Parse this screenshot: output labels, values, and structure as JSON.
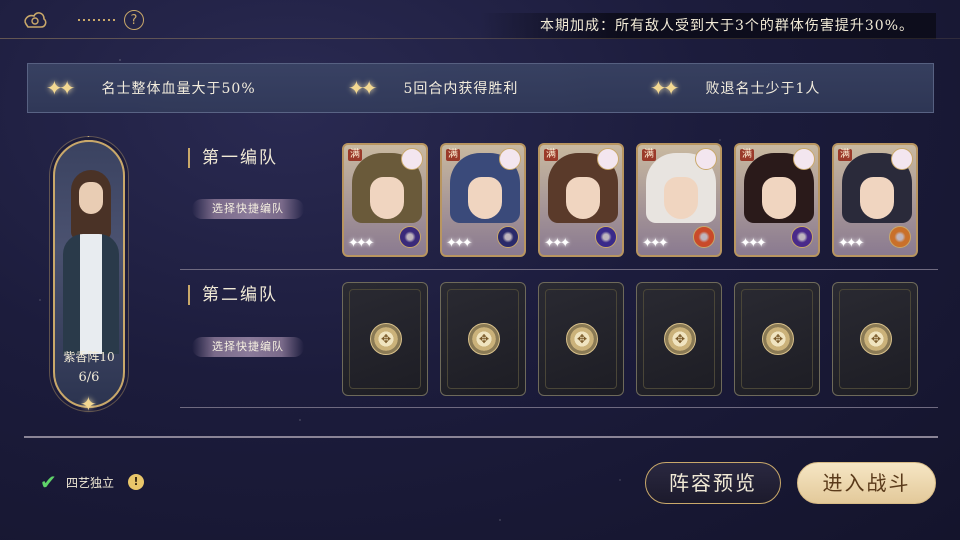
{
  "header": {
    "help_icon": "question-icon",
    "bonus_text": "本期加成：所有敌人受到大于3个的群体伤害提升30%。"
  },
  "conditions": [
    {
      "icon": "double-star-icon",
      "text": "名士整体血量大于50%"
    },
    {
      "icon": "double-star-icon",
      "text": "5回合内获得胜利"
    },
    {
      "icon": "double-star-icon",
      "text": "败退名士少于1人"
    }
  ],
  "formation": {
    "name": "紫香阵10",
    "count": "6/6"
  },
  "teams": [
    {
      "title": "第一编队",
      "quick_label": "选择快捷编队",
      "cards": [
        {
          "badge": "满",
          "hair": "#6a5a3a",
          "orb": "#3a2a7a"
        },
        {
          "badge": "满",
          "hair": "#3a4a7a",
          "orb": "#2a2a6a"
        },
        {
          "badge": "满",
          "hair": "#5a3a2a",
          "orb": "#3a2a8a"
        },
        {
          "badge": "满",
          "hair": "#e8e4e0",
          "orb": "#c94a2a"
        },
        {
          "badge": "满",
          "hair": "#2a1a1a",
          "orb": "#4a2a8a"
        },
        {
          "badge": "满",
          "hair": "#2a2a3a",
          "orb": "#c9702a"
        }
      ]
    },
    {
      "title": "第二编队",
      "quick_label": "选择快捷编队",
      "cards": [
        {},
        {},
        {},
        {},
        {},
        {}
      ]
    }
  ],
  "footer": {
    "independent_label": "四艺独立",
    "independent_checked": true,
    "preview_label": "阵容预览",
    "fight_label": "进入战斗"
  }
}
